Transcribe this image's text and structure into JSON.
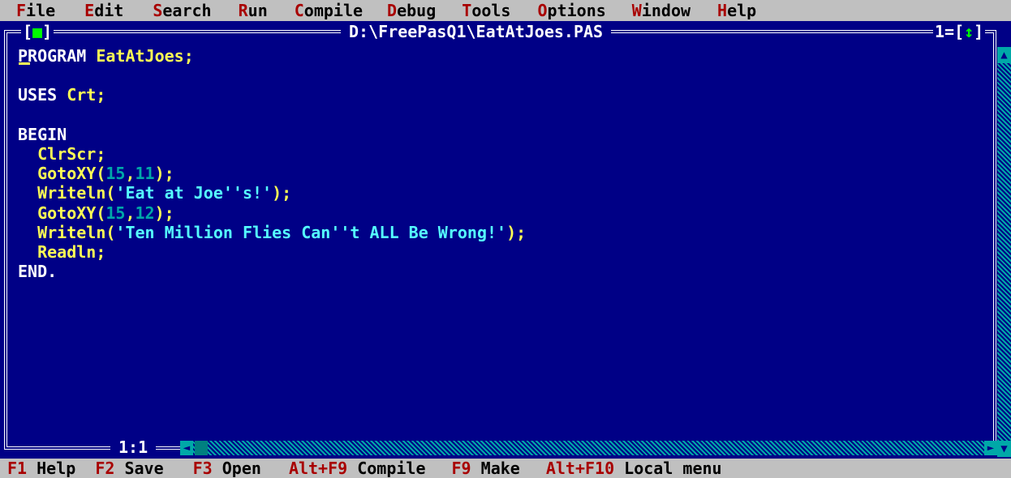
{
  "menu": [
    {
      "hotkey": "F",
      "rest": "ile"
    },
    {
      "hotkey": "E",
      "rest": "dit"
    },
    {
      "hotkey": "S",
      "rest": "earch"
    },
    {
      "hotkey": "R",
      "rest": "un"
    },
    {
      "hotkey": "C",
      "rest": "ompile"
    },
    {
      "hotkey": "D",
      "rest": "ebug"
    },
    {
      "hotkey": "T",
      "rest": "ools"
    },
    {
      "hotkey": "O",
      "rest": "ptions"
    },
    {
      "hotkey": "W",
      "rest": "indow"
    },
    {
      "hotkey": "H",
      "rest": "elp"
    }
  ],
  "window": {
    "title": "D:\\FreePasQ1\\EatAtJoes.PAS",
    "close_left": "[",
    "close_mark": "■",
    "close_right": "]",
    "number": "1=[",
    "zoom_mark": "↕",
    "number_end": "]"
  },
  "code": {
    "l1_kw": "PROGRAM",
    "l1_id": " EatAtJoes;",
    "l3_kw": "USES",
    "l3_id": " Crt;",
    "l5_kw": "BEGIN",
    "l6_id": "  ClrScr;",
    "l7_a": "  GotoXY(",
    "l7_n1": "15",
    "l7_c": ",",
    "l7_n2": "11",
    "l7_b": ");",
    "l8_a": "  Writeln(",
    "l8_s": "'Eat at Joe''s!'",
    "l8_b": ");",
    "l9_a": "  GotoXY(",
    "l9_n1": "15",
    "l9_c": ",",
    "l9_n2": "12",
    "l9_b": ");",
    "l10_a": "  Writeln(",
    "l10_s": "'Ten Million Flies Can''t ALL Be Wrong!'",
    "l10_b": ");",
    "l11_id": "  Readln;",
    "l12_kw": "END."
  },
  "status": {
    "position": "1:1"
  },
  "keys": [
    {
      "key": "F1",
      "label": " Help"
    },
    {
      "key": "F2",
      "label": " Save"
    },
    {
      "key": "F3",
      "label": " Open"
    },
    {
      "key": "Alt+F9",
      "label": " Compile"
    },
    {
      "key": "F9",
      "label": " Make"
    },
    {
      "key": "Alt+F10",
      "label": " Local menu"
    }
  ],
  "colors": {
    "background": "#000086",
    "menu_background": "#c0c0c0",
    "hotkey": "#a80000",
    "identifier": "#ffff55",
    "number": "#00a8a8",
    "string": "#55ffff"
  }
}
